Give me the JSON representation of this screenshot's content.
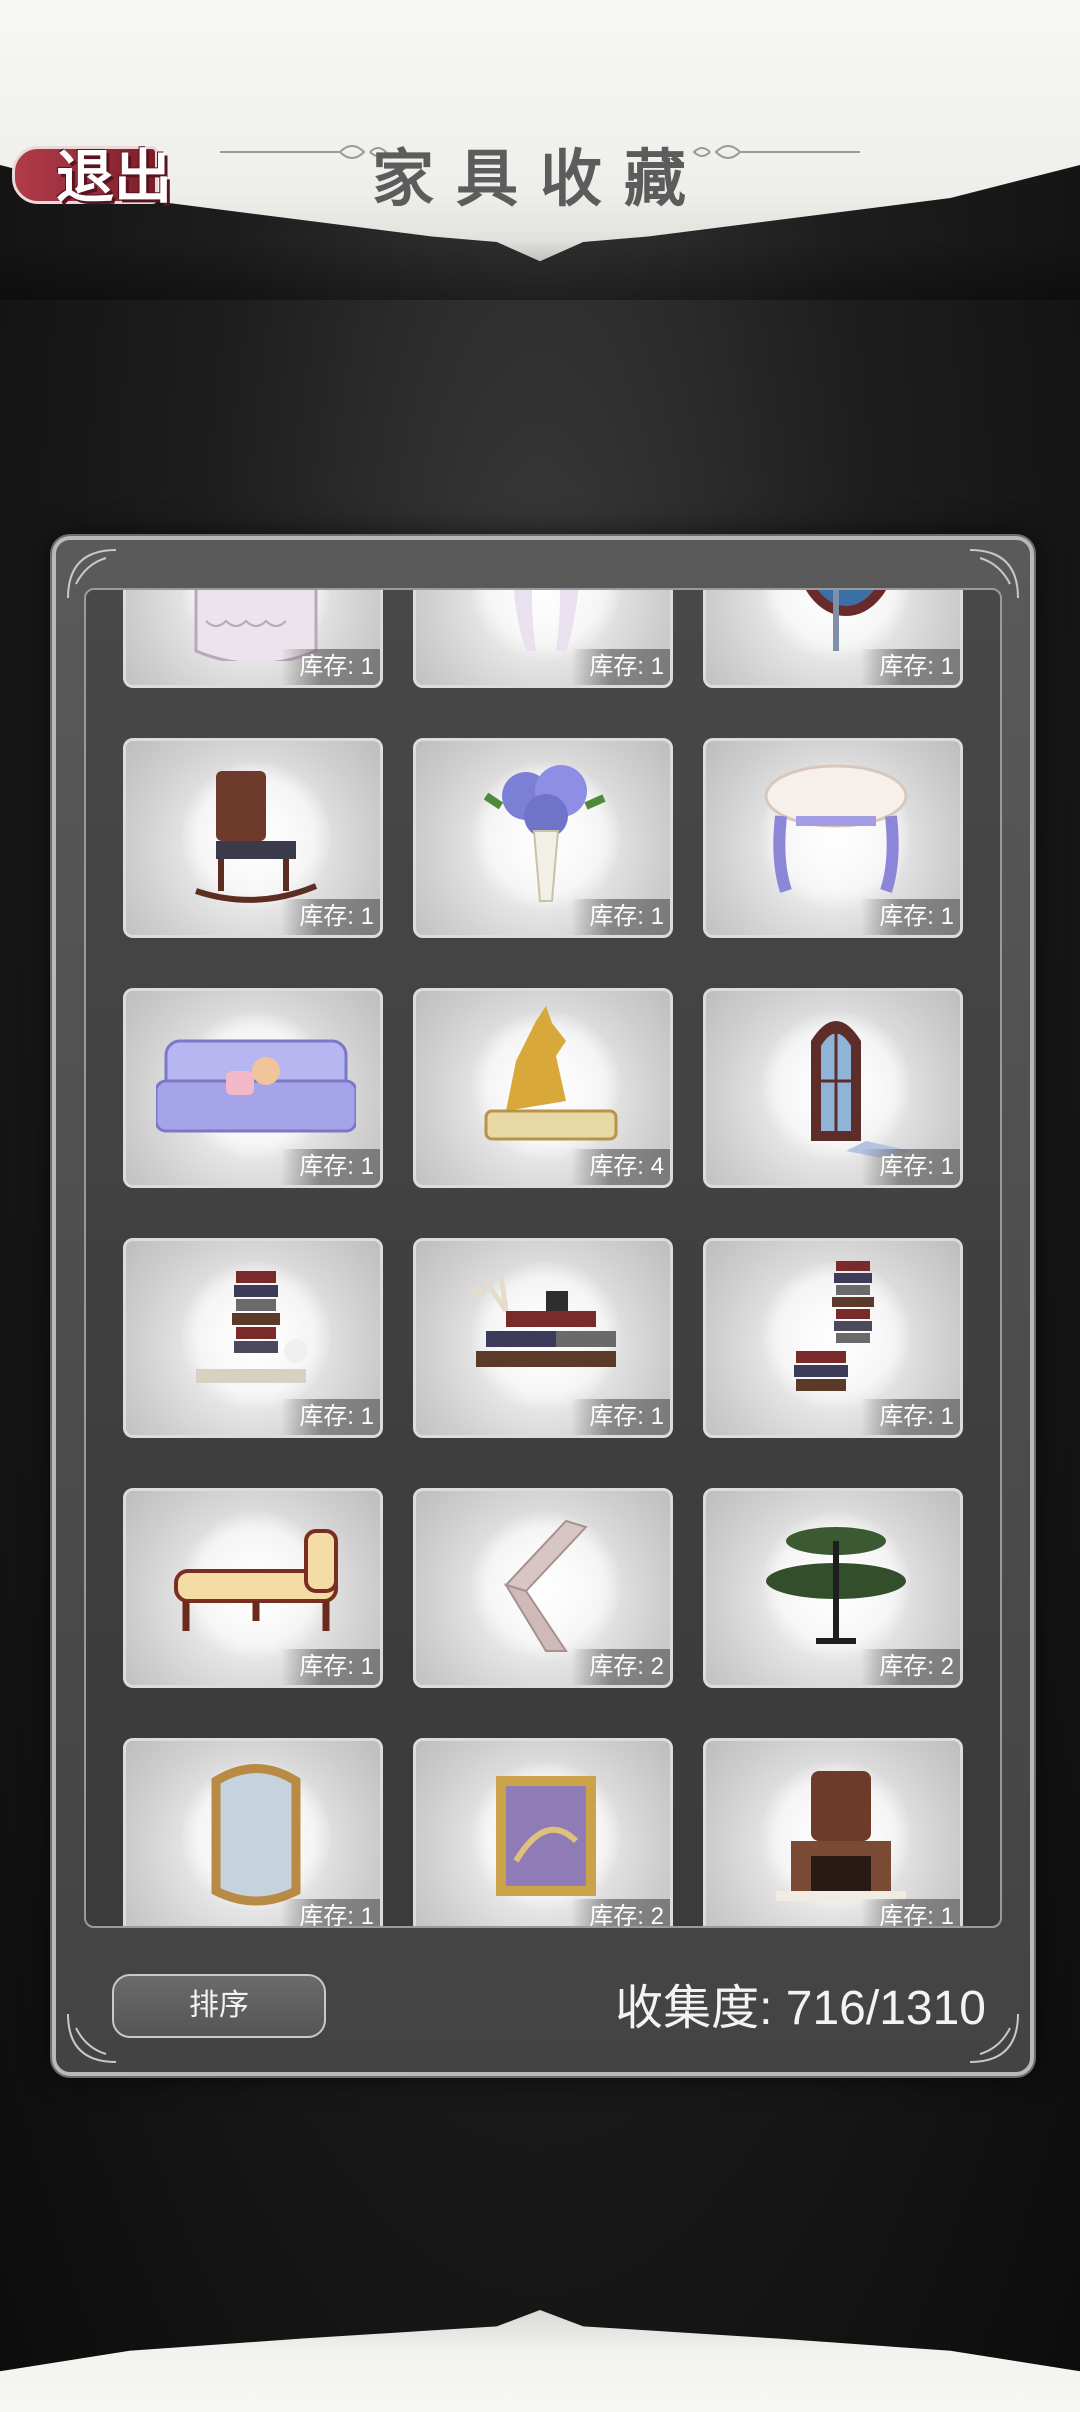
{
  "header": {
    "title": "家具收藏"
  },
  "exit_button": {
    "label": "退出"
  },
  "items": [
    {
      "name": "lace-tablecloth-table",
      "stock": "库存: 1"
    },
    {
      "name": "curtain",
      "stock": "库存: 1"
    },
    {
      "name": "oval-mirror",
      "stock": "库存: 1"
    },
    {
      "name": "rocking-chair",
      "stock": "库存: 1"
    },
    {
      "name": "hydrangea-vase",
      "stock": "库存: 1"
    },
    {
      "name": "rose-stool",
      "stock": "库存: 1"
    },
    {
      "name": "plaid-sofa",
      "stock": "库存: 1"
    },
    {
      "name": "golden-dog-statue",
      "stock": "库存: 4"
    },
    {
      "name": "stained-glass-window",
      "stock": "库存: 1"
    },
    {
      "name": "book-pile-cat",
      "stock": "库存: 1"
    },
    {
      "name": "book-pile-antlers",
      "stock": "库存: 1"
    },
    {
      "name": "book-tower",
      "stock": "库存: 1"
    },
    {
      "name": "chaise-bench",
      "stock": "库存: 1"
    },
    {
      "name": "staircase",
      "stock": "库存: 2"
    },
    {
      "name": "green-tiered-table",
      "stock": "库存: 2"
    },
    {
      "name": "ornate-gold-mirror",
      "stock": "库存: 1"
    },
    {
      "name": "framed-painting",
      "stock": "库存: 2"
    },
    {
      "name": "fireplace",
      "stock": "库存: 1"
    }
  ],
  "footer": {
    "sort_label": "排序",
    "collection_label": "收集度: 716/1310"
  },
  "colors": {
    "accent_red": "#9a2c3a",
    "panel": "#4f4f4f"
  }
}
